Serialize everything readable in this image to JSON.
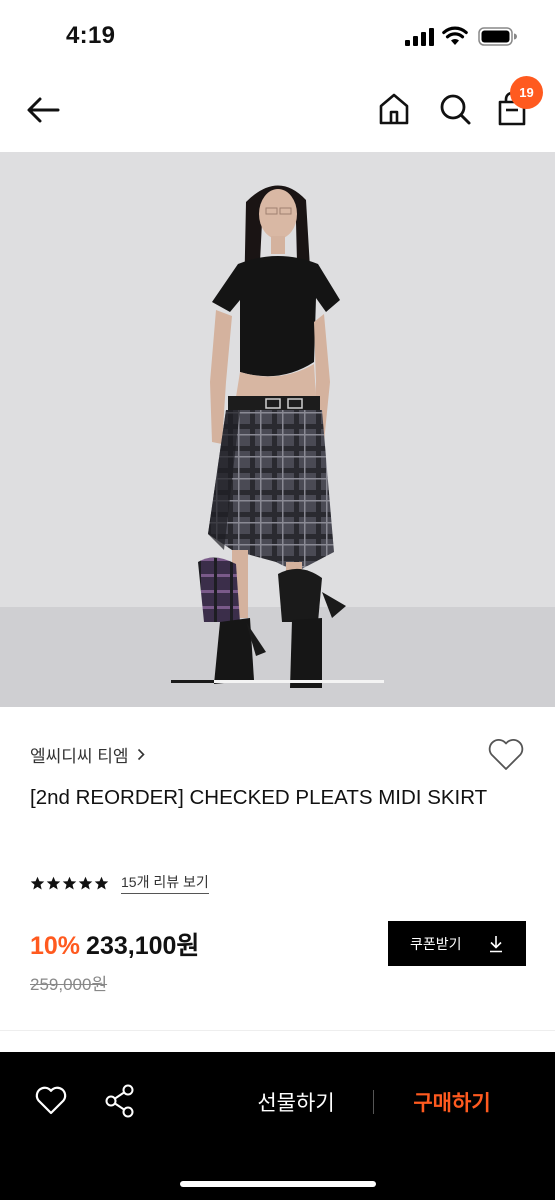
{
  "status_bar": {
    "time": "4:19"
  },
  "nav": {
    "icons": [
      "back-arrow-icon",
      "home-icon",
      "search-icon",
      "shopping-bag-icon"
    ],
    "cart_count": "19"
  },
  "gallery": {
    "image": "model-wearing-checked-pleated-midi-skirt",
    "progress": 0.2
  },
  "product": {
    "brand": "엘씨디씨 티엠",
    "title": "[2nd REORDER] CHECKED PLEATS MIDI SKIRT",
    "rating_stars": 5,
    "review_link": "15개 리뷰 보기",
    "discount": "10%",
    "price": "233,100원",
    "original_price": "259,000원",
    "coupon_button": "쿠폰받기"
  },
  "bottom_bar": {
    "gift_button": "선물하기",
    "buy_button": "구매하기"
  },
  "colors": {
    "accent": "#ff5a1f",
    "black": "#000000"
  }
}
